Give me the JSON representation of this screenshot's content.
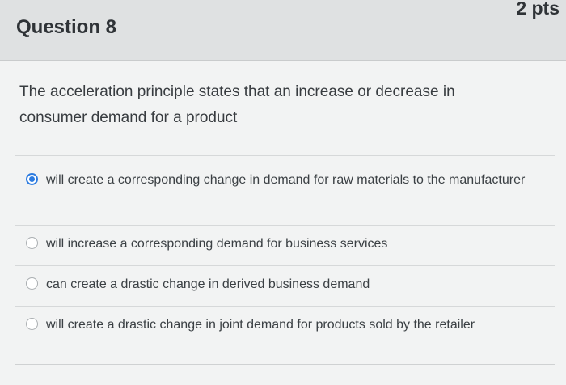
{
  "header": {
    "question_title": "Question 8",
    "points": "2 pts"
  },
  "question": {
    "text": "The acceleration principle states that an increase or decrease in consumer demand for a product"
  },
  "options": [
    {
      "label": "will create a corresponding change in demand for raw materials to the manufacturer",
      "selected": true
    },
    {
      "label": "will increase a corresponding demand for business services",
      "selected": false
    },
    {
      "label": "can create a drastic change in derived business demand",
      "selected": false
    },
    {
      "label": "will create a drastic change in joint demand for products sold by the retailer",
      "selected": false
    }
  ],
  "colors": {
    "accent": "#2c7be0",
    "header_bg": "#dfe1e2",
    "body_bg": "#f2f3f3"
  }
}
